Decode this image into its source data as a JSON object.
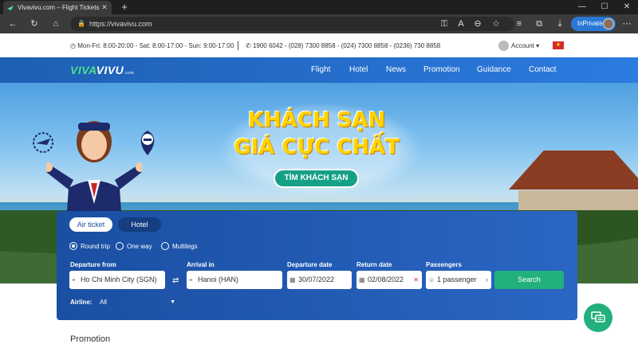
{
  "browser": {
    "tab_title": "Vivavivu.com – Flight Tickets - C",
    "tab_close": "✕",
    "new_tab": "+",
    "url": "https://vivavivu.com",
    "inprivate_label": "InPrivate",
    "window_controls": [
      "—",
      "☐",
      "✕"
    ]
  },
  "infobar": {
    "hours": "Mon-Fri: 8:00-20:00 - Sat: 8:00-17:00 - Sun: 9:00-17:00",
    "phones": "1900 6042 - (028) 7300 8858 - (024) 7300 8858 - (0236) 730 8858",
    "account_label": "Account"
  },
  "nav": {
    "logo_part1": "VIVA",
    "logo_part2": "VIVU",
    "logo_suffix": ".com",
    "links": [
      "Flight",
      "Hotel",
      "News",
      "Promotion",
      "Guidance",
      "Contact"
    ]
  },
  "hero": {
    "line1": "KHÁCH SẠN",
    "line2": "GIÁ CỰC CHẤT",
    "button": "TÌM KHÁCH SẠN"
  },
  "search": {
    "tabs": [
      "Air ticket",
      "Hotel"
    ],
    "trip_types": [
      "Round trip",
      "One way",
      "Multilegs"
    ],
    "selected_trip": "Round trip",
    "departure_from_label": "Departure from",
    "departure_from_value": "Ho Chi Minh City (SGN)",
    "arrival_label": "Arrival in",
    "arrival_value": "Hanoi (HAN)",
    "departure_date_label": "Departure date",
    "departure_date_value": "30/07/2022",
    "return_date_label": "Return date",
    "return_date_value": "02/08/2022",
    "passengers_label": "Passengers",
    "passengers_value": "1 passenger",
    "search_button": "Search",
    "airline_label": "Airline:",
    "airline_value": "All"
  },
  "promotion_heading": "Promotion",
  "colors": {
    "nav_blue": "#1e5fb3",
    "accent_green": "#22b07d",
    "promo_yellow": "#ffd400"
  }
}
